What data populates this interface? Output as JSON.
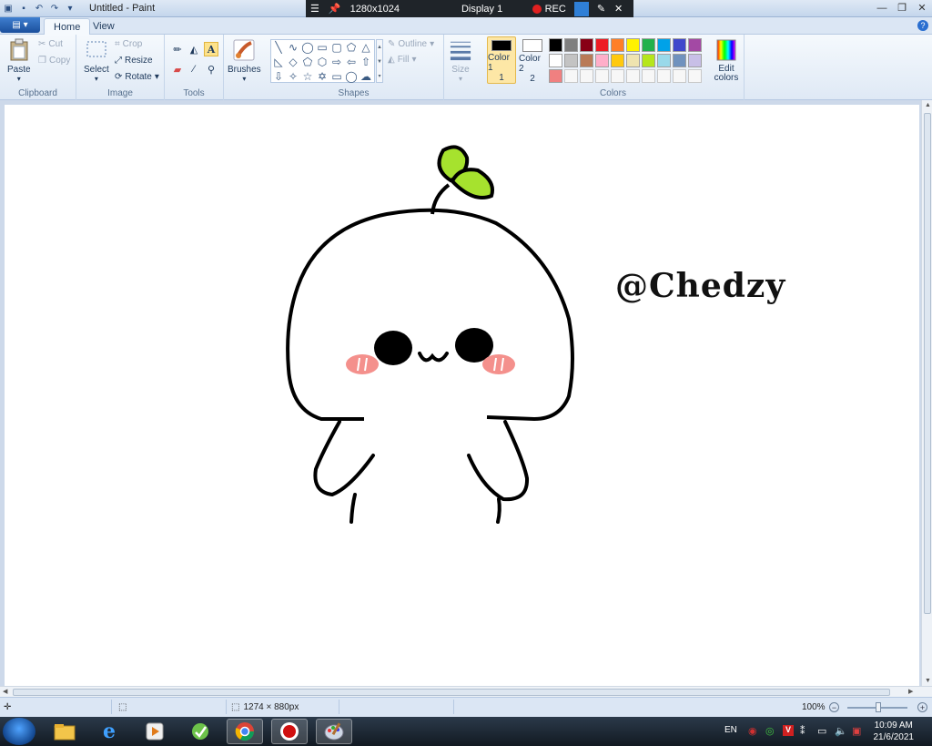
{
  "window": {
    "title": "Untitled - Paint",
    "controls": [
      "minimize-icon",
      "restore-icon",
      "close-icon"
    ]
  },
  "recorder": {
    "resolution": "1280x1024",
    "display": "Display 1",
    "rec_label": "REC"
  },
  "tabs": [
    {
      "label": "Home",
      "active": true
    },
    {
      "label": "View",
      "active": false
    }
  ],
  "ribbon": {
    "clipboard": {
      "label": "Clipboard",
      "paste": "Paste",
      "cut": "Cut",
      "copy": "Copy"
    },
    "image": {
      "label": "Image",
      "select": "Select",
      "crop": "Crop",
      "resize": "Resize",
      "rotate": "Rotate"
    },
    "tools": {
      "label": "Tools",
      "brushes": "Brushes"
    },
    "shapes": {
      "label": "Shapes",
      "outline": "Outline",
      "fill": "Fill",
      "size": "Size"
    },
    "colors": {
      "label": "Colors",
      "color1": "Color 1",
      "color1_num": "1",
      "color2": "Color 2",
      "color2_num": "2",
      "edit": "Edit colors",
      "color1_value": "#000000",
      "color2_value": "#ffffff",
      "palette": [
        "#000000",
        "#7f7f7f",
        "#880015",
        "#ed1c24",
        "#ff7f27",
        "#fff200",
        "#22b14c",
        "#00a2e8",
        "#3f48cc",
        "#a349a4",
        "#ffffff",
        "#c3c3c3",
        "#b97a57",
        "#ffaec9",
        "#ffc90e",
        "#efe4b0",
        "#b5e61d",
        "#99d9ea",
        "#7092be",
        "#c8bfe7",
        "#f08080",
        "",
        "",
        "",
        "",
        "",
        "",
        "",
        "",
        ""
      ]
    }
  },
  "canvas": {
    "signature": "@Chedzy",
    "sprout_color": "#a6e22e",
    "cheek_color": "#f4908c"
  },
  "status": {
    "canvas_size": "1274 × 880px",
    "zoom": "100%"
  },
  "taskbar": {
    "language": "EN",
    "time": "10:09 AM",
    "date": "21/6/2021"
  }
}
